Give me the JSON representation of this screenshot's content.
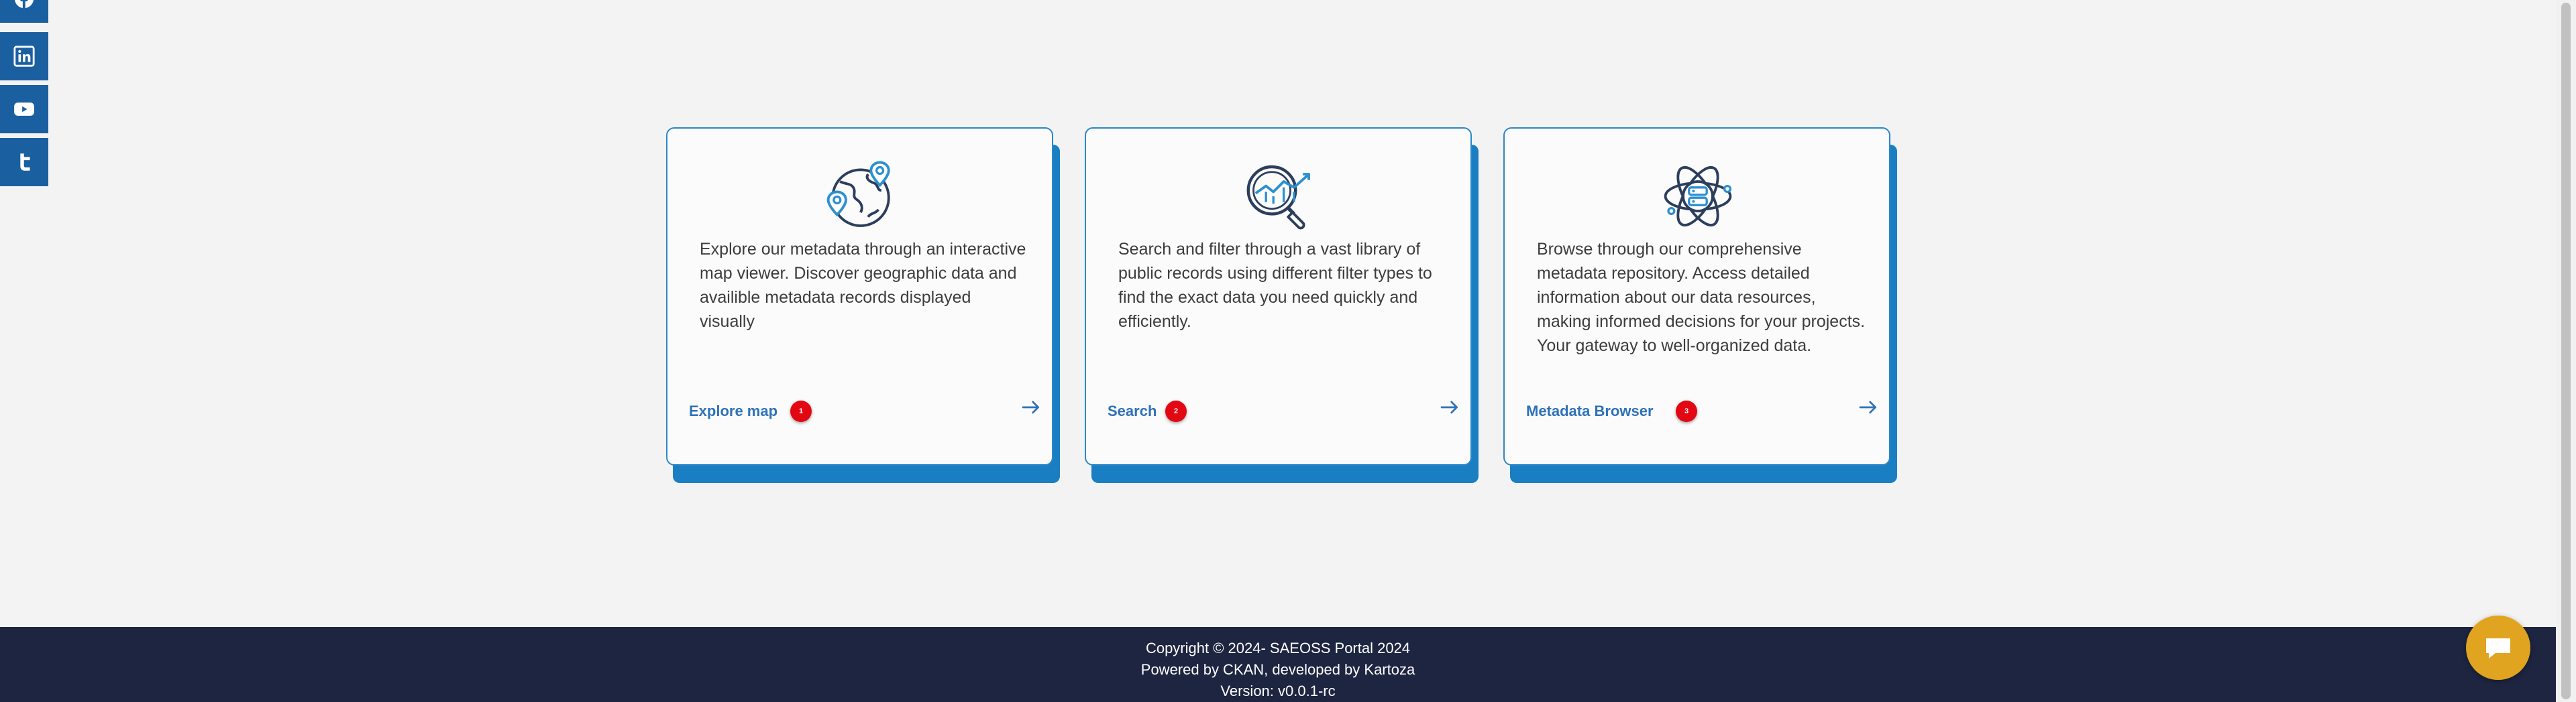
{
  "social": {
    "items": [
      {
        "icon": "facebook-icon"
      },
      {
        "icon": "linkedin-icon"
      },
      {
        "icon": "youtube-icon"
      },
      {
        "icon": "twitter-icon"
      }
    ]
  },
  "cards": [
    {
      "icon": "globe-map-pin-icon",
      "description": "Explore our metadata through an interactive map viewer. Discover geographic data and availible metadata records displayed visually",
      "link_label": "Explore map",
      "badge": "1"
    },
    {
      "icon": "search-chart-icon",
      "description": "Search and filter through a vast library of public records using different filter types to find the exact data you need quickly and efficiently.",
      "link_label": "Search",
      "badge": "2"
    },
    {
      "icon": "atom-database-icon",
      "description": "Browse through our comprehensive metadata repository. Access detailed information about our data resources, making informed decisions for your projects. Your gateway to well-organized data.",
      "link_label": "Metadata Browser",
      "badge": "3"
    }
  ],
  "footer": {
    "copyright": "Copyright © 2024- SAEOSS Portal 2024",
    "powered": "Powered by CKAN, developed by Kartoza",
    "version": "Version: v0.0.1-rc"
  },
  "colors": {
    "social_bg": "#1a5fa0",
    "card_border": "#2b86c9",
    "card_shadow": "#1a7fc2",
    "link": "#2e72b8",
    "badge": "#e30613",
    "footer_bg": "#1d2541",
    "chat": "#e0a420"
  },
  "chat": {
    "icon": "chat-bubble-icon"
  }
}
